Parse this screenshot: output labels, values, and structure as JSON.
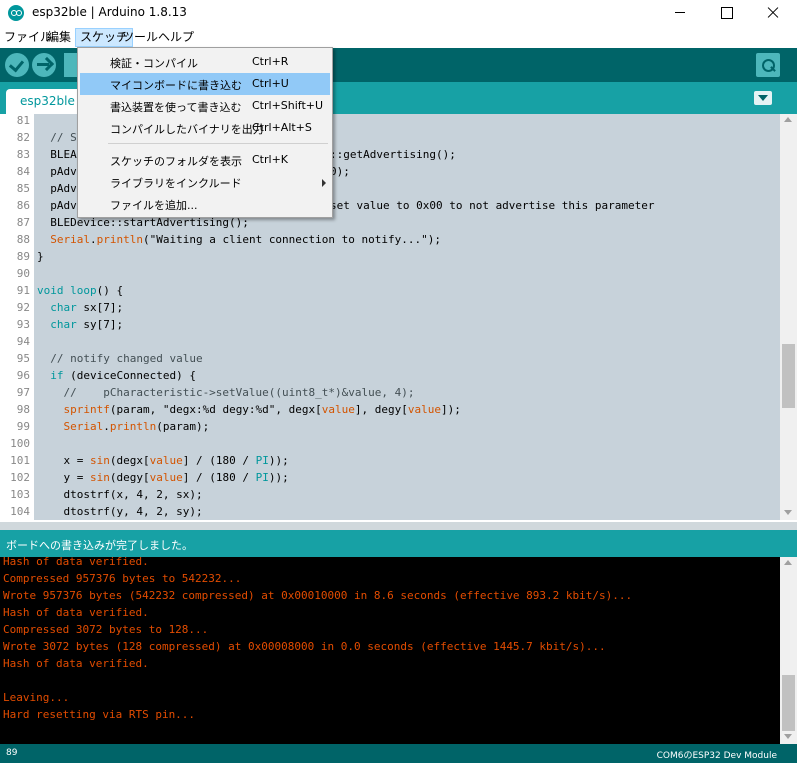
{
  "window": {
    "title": "esp32ble | Arduino 1.8.13"
  },
  "menubar": [
    "ファイル",
    "編集",
    "スケッチ",
    "ツール",
    "ヘルプ"
  ],
  "tab": {
    "label": "esp32ble"
  },
  "sketch_menu": {
    "items": [
      {
        "label": "検証・コンパイル",
        "shortcut": "Ctrl+R"
      },
      {
        "label": "マイコンボードに書き込む",
        "shortcut": "Ctrl+U"
      },
      {
        "label": "書込装置を使って書き込む",
        "shortcut": "Ctrl+Shift+U"
      },
      {
        "label": "コンパイルしたバイナリを出力",
        "shortcut": "Ctrl+Alt+S"
      },
      {
        "label": "スケッチのフォルダを表示",
        "shortcut": "Ctrl+K"
      },
      {
        "label": "ライブラリをインクルード",
        "shortcut": ""
      },
      {
        "label": "ファイルを追加...",
        "shortcut": ""
      }
    ]
  },
  "editor": {
    "line_numbers": [
      "81",
      "82",
      "83",
      "84",
      "85",
      "86",
      "87",
      "88",
      "89",
      "90",
      "91",
      "92",
      "93",
      "94",
      "95",
      "96",
      "97",
      "98",
      "99",
      "100",
      "101",
      "102",
      "103",
      "104"
    ],
    "lines": {
      "l82": "  // S",
      "l83a": "  BLEA",
      "l83b": "::getAdvertising();",
      "l84a": "  pAdv",
      "l84b": "0);",
      "l85": "  pAdv",
      "l86a": "  pAdv",
      "l86b": "set value to 0x00 to not advertise this parameter",
      "l87": "  BLEDevice::startAdvertising();",
      "l88a": "Serial",
      "l88b": ".",
      "l88c": "println",
      "l88d": "(\"Waiting a client connection to notify...\");",
      "l89": "}",
      "l91a": "void",
      "l91b": " ",
      "l91c": "loop",
      "l91d": "() {",
      "l92a": "char",
      "l92b": " sx[7];",
      "l93a": "char",
      "l93b": " sy[7];",
      "l95": "  // notify changed value",
      "l96a": "if",
      "l96b": " (deviceConnected) {",
      "l97": "    //    pCharacteristic->setValue((uint8_t*)&value, 4);",
      "l98a": "sprintf",
      "l98b": "(param, \"degx:%d degy:%d\", degx[",
      "l98c": "value",
      "l98d": "], degy[",
      "l98e": "value",
      "l98f": "]);",
      "l99a": "Serial",
      "l99b": ".",
      "l99c": "println",
      "l99d": "(param);",
      "l101a": "    x = ",
      "l101b": "sin",
      "l101c": "(degx[",
      "l101d": "value",
      "l101e": "] / (180 / ",
      "l101f": "PI",
      "l101g": "));",
      "l102a": "    y = ",
      "l102b": "sin",
      "l102c": "(degy[",
      "l102d": "value",
      "l102e": "] / (180 / ",
      "l102f": "PI",
      "l102g": "));",
      "l103": "    dtostrf(x, 4, 2, sx);",
      "l104": "    dtostrf(y, 4, 2, sy);"
    }
  },
  "status": {
    "message": "ボードへの書き込みが完了しました。"
  },
  "console": {
    "lines": [
      "Hash of data verified.",
      "Compressed 957376 bytes to 542232...",
      "Wrote 957376 bytes (542232 compressed) at 0x00010000 in 8.6 seconds (effective 893.2 kbit/s)...",
      "Hash of data verified.",
      "Compressed 3072 bytes to 128...",
      "Wrote 3072 bytes (128 compressed) at 0x00008000 in 0.0 seconds (effective 1445.7 kbit/s)...",
      "Hash of data verified.",
      "",
      "Leaving...",
      "Hard resetting via RTS pin..."
    ]
  },
  "footer": {
    "line": "89",
    "board": "COM6のESP32 Dev Module"
  },
  "colors": {
    "teal_dark": "#006468",
    "teal": "#17a1a5",
    "console_text": "#e34c00",
    "highlight": "#91c9f7"
  }
}
